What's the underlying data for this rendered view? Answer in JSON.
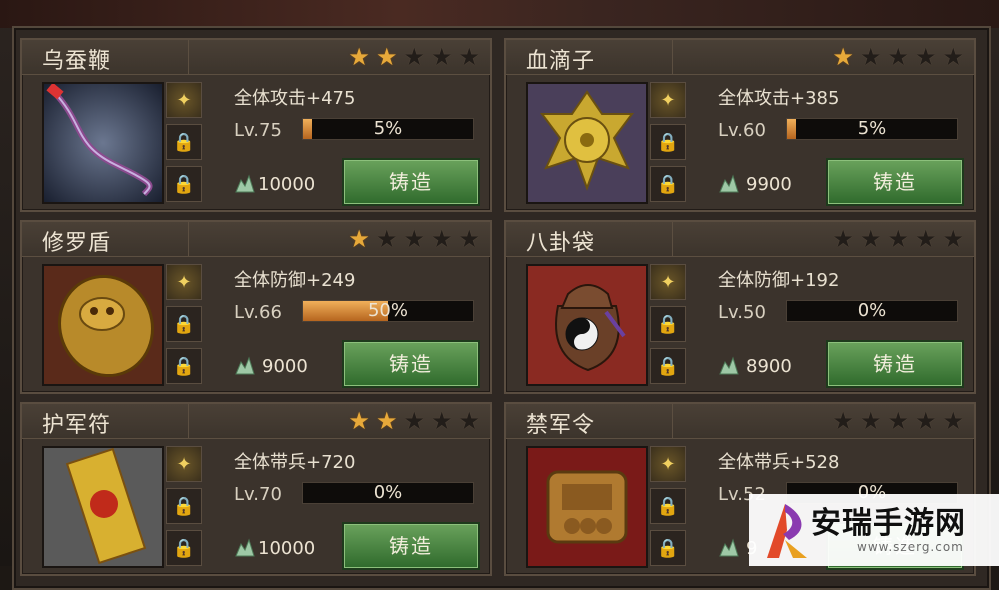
{
  "cards": [
    {
      "name": "乌蚕鞭",
      "stars": 2,
      "stat": "全体攻击+475",
      "level": "Lv.75",
      "progress": 0.05,
      "progress_text": "5%",
      "cost": "10000",
      "button": "铸造"
    },
    {
      "name": "血滴子",
      "stars": 1,
      "stat": "全体攻击+385",
      "level": "Lv.60",
      "progress": 0.05,
      "progress_text": "5%",
      "cost": "9900",
      "button": "铸造"
    },
    {
      "name": "修罗盾",
      "stars": 1,
      "stat": "全体防御+249",
      "level": "Lv.66",
      "progress": 0.5,
      "progress_text": "50%",
      "cost": "9000",
      "button": "铸造"
    },
    {
      "name": "八卦袋",
      "stars": 0,
      "stat": "全体防御+192",
      "level": "Lv.50",
      "progress": 0,
      "progress_text": "0%",
      "cost": "8900",
      "button": "铸造"
    },
    {
      "name": "护军符",
      "stars": 2,
      "stat": "全体带兵+720",
      "level": "Lv.70",
      "progress": 0,
      "progress_text": "0%",
      "cost": "10000",
      "button": "铸造"
    },
    {
      "name": "禁军令",
      "stars": 0,
      "stat": "全体带兵+528",
      "level": "Lv.52",
      "progress": 0,
      "progress_text": "0%",
      "cost": "9",
      "button": "铸造"
    }
  ],
  "watermark": {
    "text": "安瑞手游网",
    "url": "www.szerg.com"
  },
  "colors": {
    "star_on": "#e7a93a",
    "button": "#3f7a36"
  }
}
